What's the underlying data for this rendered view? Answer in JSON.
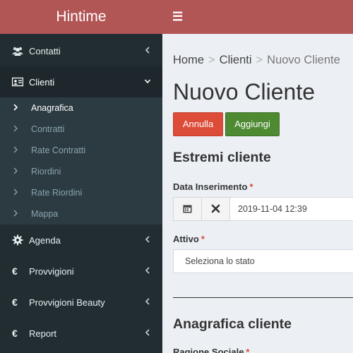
{
  "app": {
    "title": "Hintime"
  },
  "sidebar": {
    "items": [
      {
        "label": "Contatti",
        "icon": "users-icon"
      },
      {
        "label": "Clienti",
        "icon": "id-card-icon"
      },
      {
        "label": "Agenda",
        "icon": "gear-icon"
      },
      {
        "label": "Provvigioni",
        "icon": "euro-icon"
      },
      {
        "label": "Provvigioni Beauty",
        "icon": "euro-icon"
      },
      {
        "label": "Report",
        "icon": "euro-icon"
      }
    ],
    "submenu": [
      {
        "label": "Anagrafica"
      },
      {
        "label": "Contratti"
      },
      {
        "label": "Rate Contratti"
      },
      {
        "label": "Riordini"
      },
      {
        "label": "Rate Riordini"
      },
      {
        "label": "Mappa"
      }
    ],
    "euro_symbol": "€"
  },
  "breadcrumb": {
    "home": "Home",
    "section": "Clienti",
    "current": "Nuovo Cliente"
  },
  "page": {
    "title": "Nuovo Cliente"
  },
  "buttons": {
    "cancel": "Annulla",
    "add": "Aggiungi"
  },
  "form": {
    "section1_title": "Estremi cliente",
    "date_label": "Data Inserimento",
    "date_value": "2019-11-04 12:39",
    "active_label": "Attivo",
    "active_placeholder": "Seleziona lo stato",
    "section2_title": "Anagrafica cliente",
    "business_name_label": "Ragione Sociale",
    "required_mark": "*"
  },
  "colors": {
    "header": "#b25555",
    "sidebar": "#222d32",
    "cancel_button": "#dd4b39",
    "add_button": "#4e8a32",
    "required": "#dd4b39"
  }
}
